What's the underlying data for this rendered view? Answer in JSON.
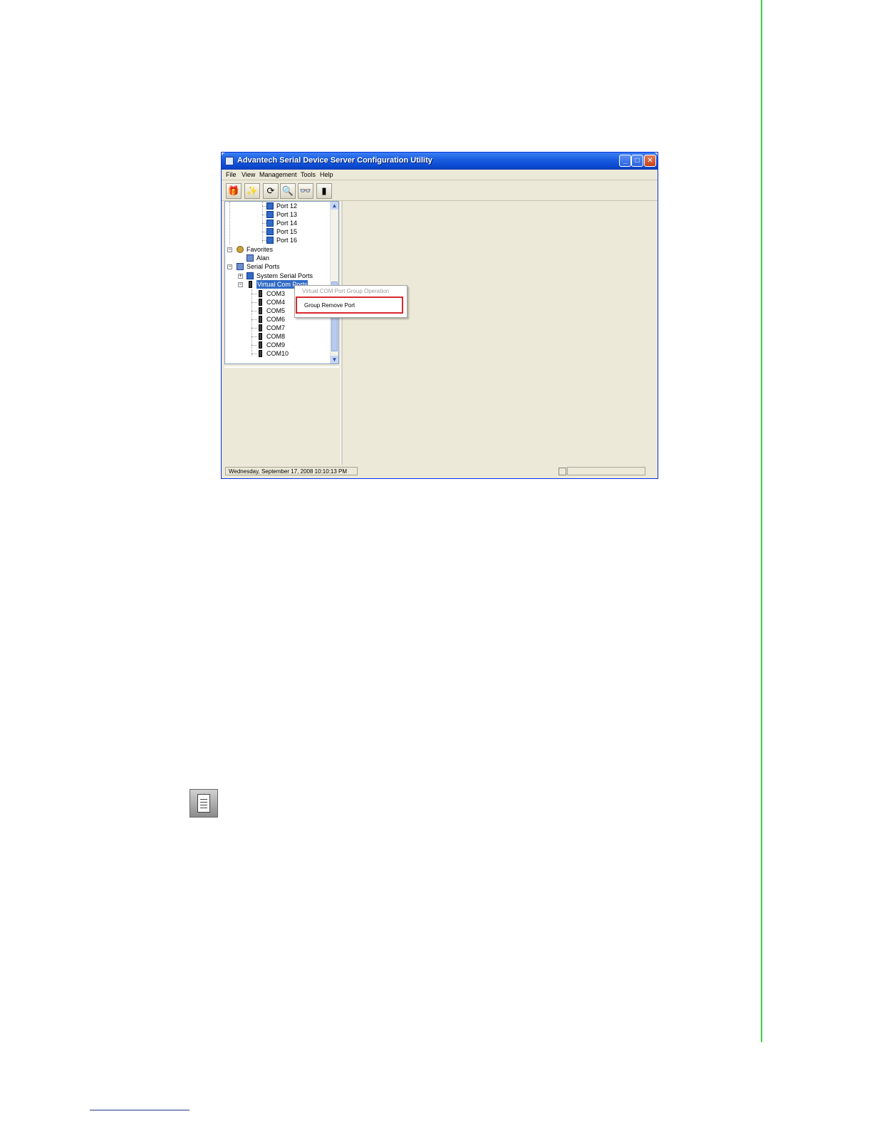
{
  "window": {
    "title": "Advantech Serial Device Server Configuration Utility",
    "controls": [
      "_",
      "□",
      "✕"
    ]
  },
  "menubar": [
    "File",
    "View",
    "Management",
    "Tools",
    "Help"
  ],
  "toolbar": {
    "icons": [
      "gift-icon",
      "wand-icon",
      "refresh-icon",
      "search-icon",
      "binoculars-icon",
      "device-icon"
    ]
  },
  "tree": {
    "ports": [
      "Port 12",
      "Port 13",
      "Port 14",
      "Port 15",
      "Port 16"
    ],
    "favorites": "Favorites",
    "favorite_child": "Alan",
    "serial_ports": "Serial Ports",
    "system_serial_ports": "System Serial Ports",
    "virtual_com_ports": "Virtual Com Ports",
    "com_ports": [
      "COM3",
      "COM4",
      "COM5",
      "COM6",
      "COM7",
      "COM8",
      "COM9",
      "COM10"
    ]
  },
  "context_menu": {
    "header": "Virtual COM Port Group Operation",
    "item": "Group Remove Port",
    "highlight_color": "#d9272e"
  },
  "statusbar": {
    "datetime": "Wednesday, September 17, 2008  10:10:13 PM"
  },
  "colors": {
    "titlebar": "#0a49d0",
    "selection": "#316ac5",
    "page_rule": "#3fd23f"
  }
}
